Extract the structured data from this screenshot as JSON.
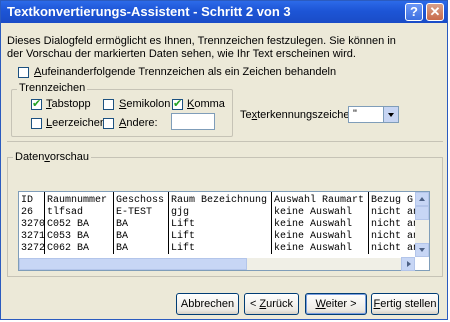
{
  "window": {
    "title": "Textkonvertierungs-Assistent - Schritt 2 von 3",
    "help_glyph": "?",
    "close_glyph": "✕"
  },
  "description": {
    "line1": "Dieses Dialogfeld ermöglicht es Ihnen, Trennzeichen festzulegen. Sie können in",
    "line2": "der Vorschau der markierten Daten sehen, wie Ihr Text erscheinen wird."
  },
  "consecutive_delimiters": {
    "checked": false,
    "accel": "A",
    "label_rest": "ufeinanderfolgende Trennzeichen als ein Zeichen behandeln"
  },
  "delimiters": {
    "group_title": "Trennzeichen",
    "tab": {
      "accel": "T",
      "rest": "abstopp",
      "checked": true
    },
    "semicolon": {
      "accel": "S",
      "rest": "emikolon",
      "checked": false
    },
    "comma": {
      "accel": "K",
      "rest": "omma",
      "checked": true
    },
    "space": {
      "accel": "L",
      "rest": "eerzeichen",
      "checked": false
    },
    "other": {
      "pre": "",
      "accel": "A",
      "rest": "ndere:",
      "checked": false,
      "value": ""
    }
  },
  "text_qualifier": {
    "pre": "Te",
    "accel": "x",
    "rest": "terkennungszeichen:",
    "value": "\""
  },
  "preview": {
    "label_pre": "Daten",
    "accel": "v",
    "label_rest": "orschau",
    "columns": [
      "ID",
      "Raumnummer",
      "Geschoss",
      "Raum Bezeichnung",
      "Auswahl Raumart",
      "Bezug G"
    ],
    "rows": [
      [
        "26",
        "tlfsad",
        "E-TEST",
        "gjg",
        "keine Auswahl",
        "nicht an"
      ],
      [
        "3270",
        "C052 BA",
        "BA",
        "Lift",
        "keine Auswahl",
        "nicht an"
      ],
      [
        "3271",
        "C053 BA",
        "BA",
        "Lift",
        "keine Auswahl",
        "nicht an"
      ],
      [
        "3272",
        "C062 BA",
        "BA",
        "Lift",
        "keine Auswahl",
        "nicht an"
      ]
    ]
  },
  "buttons": {
    "cancel": "Abbrechen",
    "back_pre": "< ",
    "back_accel": "Z",
    "back_rest": "urück",
    "next_accel": "W",
    "next_rest": "eiter >",
    "finish_accel": "F",
    "finish_rest": "ertig stellen"
  }
}
